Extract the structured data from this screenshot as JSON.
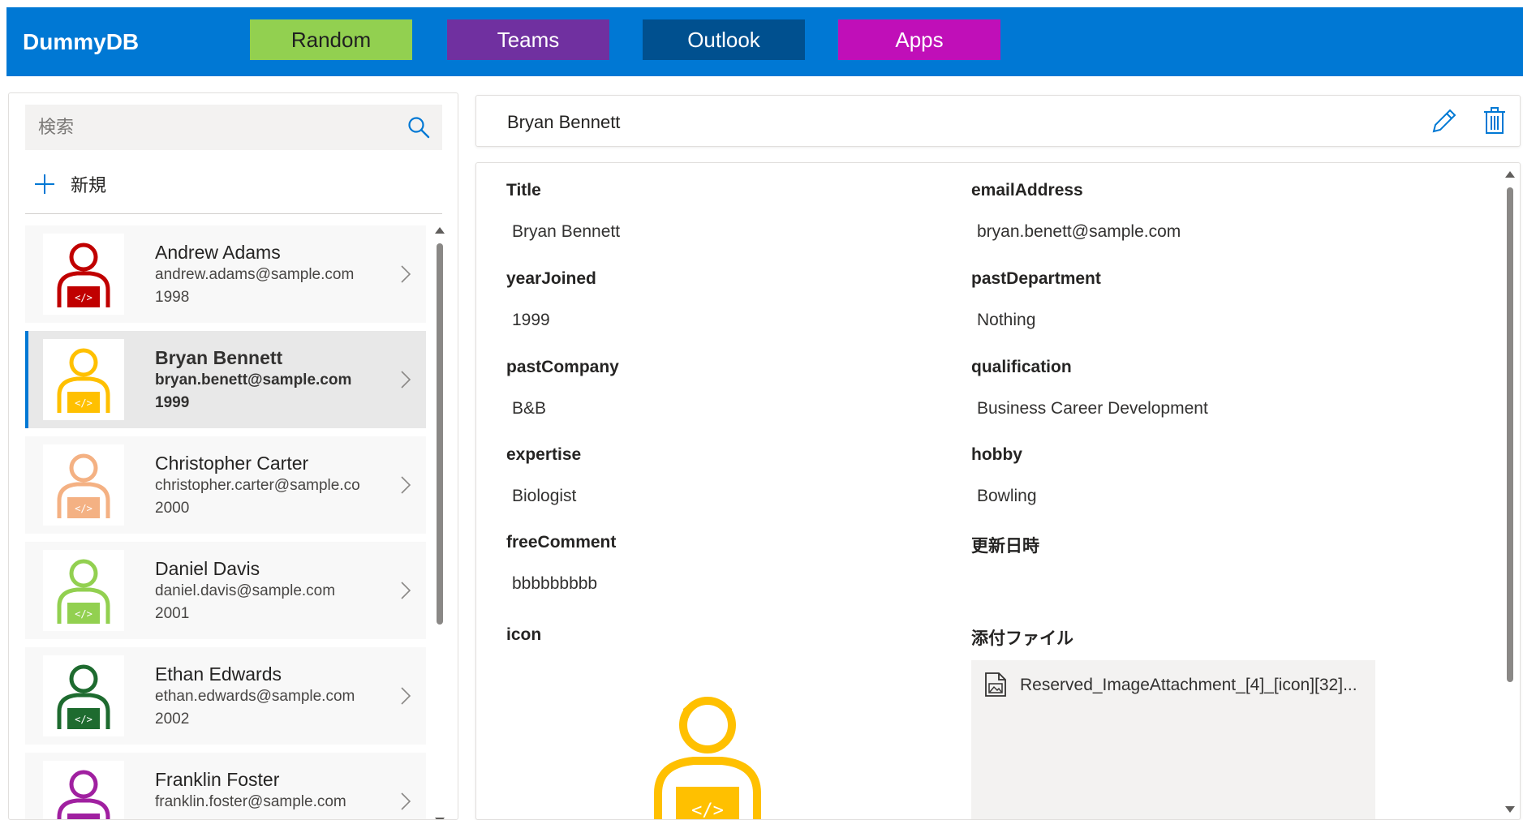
{
  "app": {
    "title": "DummyDB",
    "nav_buttons": [
      {
        "label": "Random",
        "color": "#92d050"
      },
      {
        "label": "Teams",
        "color": "#7030a0"
      },
      {
        "label": "Outlook",
        "color": "#00508f"
      },
      {
        "label": "Apps",
        "color": "#c00fb8"
      }
    ],
    "header_color": "#0078d4"
  },
  "sidebar": {
    "search_placeholder": "検索",
    "new_label": "新規",
    "items": [
      {
        "name": "Andrew Adams",
        "email": "andrew.adams@sample.com",
        "year": "1998",
        "avatar_color": "#c00000"
      },
      {
        "name": "Bryan Bennett",
        "email": "bryan.benett@sample.com",
        "year": "1999",
        "avatar_color": "#ffc000"
      },
      {
        "name": "Christopher Carter",
        "email": "christopher.carter@sample.co",
        "year": "2000",
        "avatar_color": "#f4b183"
      },
      {
        "name": "Daniel Davis",
        "email": "daniel.davis@sample.com",
        "year": "2001",
        "avatar_color": "#92d050"
      },
      {
        "name": "Ethan Edwards",
        "email": "ethan.edwards@sample.com",
        "year": "2002",
        "avatar_color": "#1e6b2f"
      },
      {
        "name": "Franklin Foster",
        "email": "franklin.foster@sample.com",
        "year": "",
        "avatar_color": "#a020a0"
      }
    ]
  },
  "detail": {
    "header_title": "Bryan Bennett",
    "fields": {
      "title_label": "Title",
      "title_value": "Bryan Bennett",
      "email_label": "emailAddress",
      "email_value": "bryan.benett@sample.com",
      "year_label": "yearJoined",
      "year_value": "1999",
      "dept_label": "pastDepartment",
      "dept_value": "Nothing",
      "company_label": "pastCompany",
      "company_value": "B&B",
      "qual_label": "qualification",
      "qual_value": "Business Career Development",
      "expertise_label": "expertise",
      "expertise_value": "Biologist",
      "hobby_label": "hobby",
      "hobby_value": "Bowling",
      "comment_label": "freeComment",
      "comment_value": "bbbbbbbbb",
      "updated_label": "更新日時",
      "icon_label": "icon",
      "attach_label": "添付ファイル",
      "attach_file": "Reserved_ImageAttachment_[4]_[icon][32]..."
    }
  }
}
